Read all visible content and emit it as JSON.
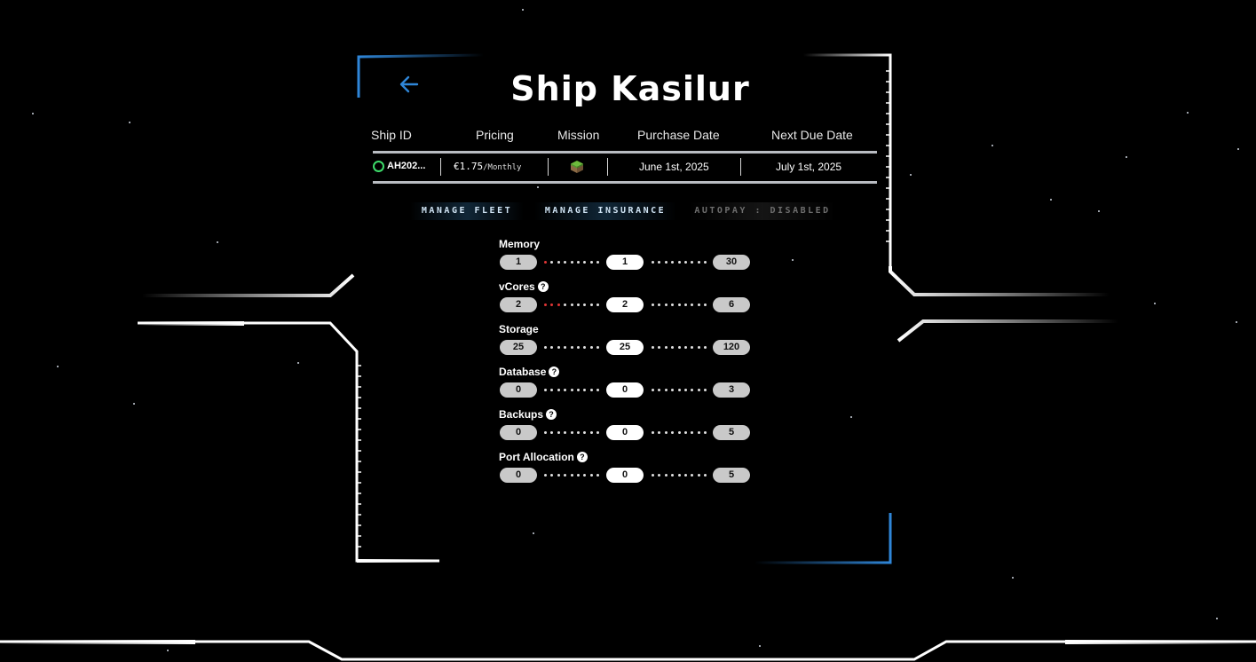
{
  "page": {
    "title": "Ship Kasilur",
    "back_icon": "arrow-left-icon"
  },
  "colors": {
    "accent_blue": "#2f86d8",
    "status_online": "#3ddc6a",
    "over_limit_dot": "#e03535"
  },
  "table": {
    "headers": [
      "Ship ID",
      "Pricing",
      "Mission",
      "Purchase Date",
      "Next Due Date"
    ],
    "row": {
      "ship_id": "AH202...",
      "price": "€1.75",
      "price_period": "/Monthly",
      "mission_icon": "grass-block-icon",
      "purchase_date": "June 1st, 2025",
      "next_due_date": "July 1st, 2025"
    }
  },
  "actions": {
    "manage_fleet": "MANAGE FLEET",
    "manage_insurance": "MANAGE INSURANCE",
    "autopay": "AUTOPAY : DISABLED"
  },
  "resources": [
    {
      "label": "Memory",
      "help": false,
      "min": "1",
      "current": "1",
      "max": "30",
      "red_dots": 1
    },
    {
      "label": "vCores",
      "help": true,
      "min": "2",
      "current": "2",
      "max": "6",
      "red_dots": 3
    },
    {
      "label": "Storage",
      "help": false,
      "min": "25",
      "current": "25",
      "max": "120",
      "red_dots": 0
    },
    {
      "label": "Database",
      "help": true,
      "min": "0",
      "current": "0",
      "max": "3",
      "red_dots": 0
    },
    {
      "label": "Backups",
      "help": true,
      "min": "0",
      "current": "0",
      "max": "5",
      "red_dots": 0
    },
    {
      "label": "Port Allocation",
      "help": true,
      "min": "0",
      "current": "0",
      "max": "5",
      "red_dots": 0
    }
  ]
}
